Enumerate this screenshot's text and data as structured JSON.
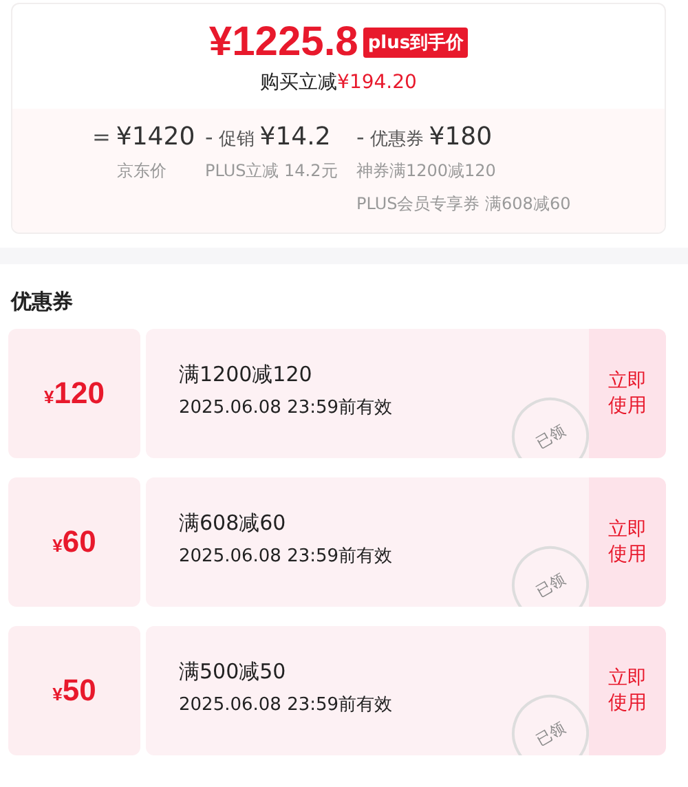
{
  "price": {
    "amount": "¥1225.8",
    "badge": "plus到手价",
    "saving_label": "购买立减",
    "saving_amount": "¥194.20"
  },
  "breakdown": [
    {
      "operator": "=",
      "amount": "¥1420",
      "notes": [
        "京东价"
      ]
    },
    {
      "operator": "-",
      "label": "促销",
      "amount": "¥14.2",
      "notes": [
        "PLUS立减 14.2元"
      ]
    },
    {
      "operator": "-",
      "label": "优惠券",
      "amount": "¥180",
      "notes": [
        "神券满1200减120",
        "PLUS会员专享券 满608减60"
      ]
    }
  ],
  "coupons_title": "优惠券",
  "coupons": [
    {
      "value": "120",
      "currency": "¥",
      "condition": "满1200减120",
      "validity": "2025.06.08 23:59前有效",
      "stamp": "已领",
      "action": "立即使用"
    },
    {
      "value": "60",
      "currency": "¥",
      "condition": "满608减60",
      "validity": "2025.06.08 23:59前有效",
      "stamp": "已领",
      "action": "立即使用"
    },
    {
      "value": "50",
      "currency": "¥",
      "condition": "满500减50",
      "validity": "2025.06.08 23:59前有效",
      "stamp": "已领",
      "action": "立即使用"
    }
  ]
}
